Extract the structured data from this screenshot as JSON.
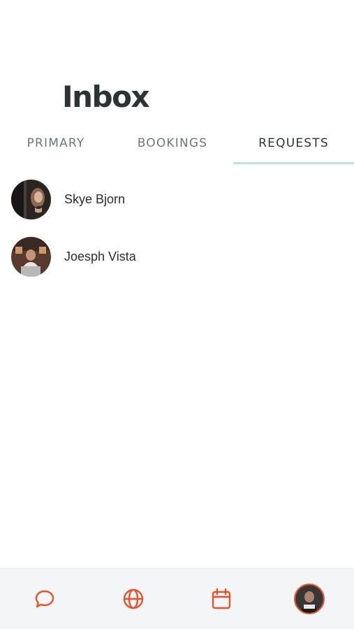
{
  "header": {
    "title": "Inbox"
  },
  "tabs": [
    {
      "label": "PRIMARY"
    },
    {
      "label": "BOOKINGS"
    },
    {
      "label": "REQUESTS",
      "active": true
    }
  ],
  "conversations": [
    {
      "name": "Skye Bjorn",
      "avatar": "woman-portrait-avatar"
    },
    {
      "name": "Joesph Vista",
      "avatar": "man-portrait-avatar"
    }
  ],
  "bottom_nav": [
    {
      "icon": "chat-bubble-icon"
    },
    {
      "icon": "globe-icon"
    },
    {
      "icon": "calendar-icon"
    },
    {
      "icon": "profile-avatar"
    }
  ],
  "colors": {
    "accent": "#e4532c",
    "tab_indicator": "#bfe0f1",
    "title": "#2b3335",
    "nav_background": "#f4f5f6"
  }
}
